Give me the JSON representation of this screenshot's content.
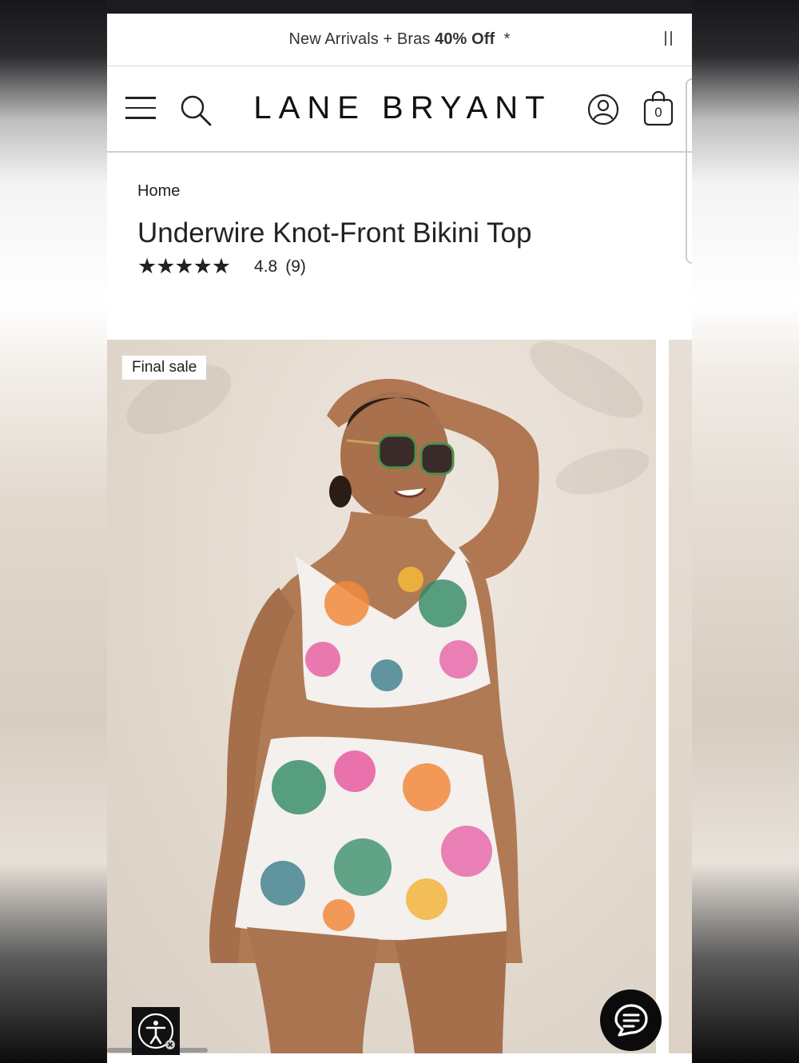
{
  "promo": {
    "text_before": "New Arrivals + Bras ",
    "text_bold": "40% Off",
    "text_after": "  *"
  },
  "header": {
    "logo": "LANE BRYANT",
    "bag_count": "0"
  },
  "breadcrumb": "Home",
  "product": {
    "title": "Underwire Knot-Front Bikini Top",
    "stars": "★★★★★",
    "rating": "4.8",
    "review_count": "(9)",
    "rating_value": 4.8
  },
  "gallery": {
    "badge": "Final sale"
  },
  "icons": {
    "menu": "menu-icon",
    "search": "search-icon",
    "account": "account-icon",
    "bag": "shopping-bag-icon",
    "accessibility": "accessibility-icon",
    "chat": "chat-icon",
    "pause": "pause-icon"
  }
}
